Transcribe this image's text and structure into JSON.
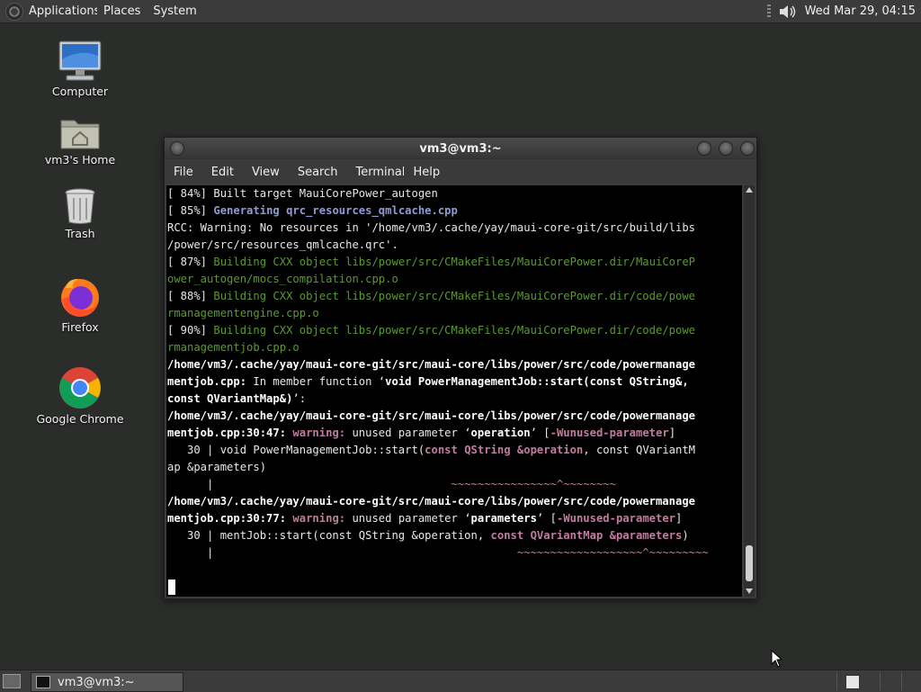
{
  "top_panel": {
    "menus": [
      "Applications",
      "Places",
      "System"
    ],
    "clock": "Wed Mar 29, 04:15"
  },
  "desktop_icons": [
    {
      "label": "Computer",
      "icon": "computer-icon"
    },
    {
      "label": "vm3's Home",
      "icon": "home-folder-icon"
    },
    {
      "label": "Trash",
      "icon": "trash-icon"
    },
    {
      "label": "Firefox",
      "icon": "firefox-icon"
    },
    {
      "label": "Google Chrome",
      "icon": "chrome-icon"
    }
  ],
  "window": {
    "title": "vm3@vm3:~",
    "menus": [
      "File",
      "Edit",
      "View",
      "Search",
      "Terminal",
      "Help"
    ]
  },
  "terminal": {
    "lines": [
      [
        {
          "t": "[ 84%] Built target MauiCorePower_autogen"
        }
      ],
      [
        {
          "t": "[ 85%] "
        },
        {
          "t": "Generating qrc_resources_qmlcache.cpp",
          "s": "blue"
        }
      ],
      [
        {
          "t": "RCC: Warning: No resources in '/home/vm3/.cache/yay/maui-core-git/src/build/libs"
        }
      ],
      [
        {
          "t": "/power/src/resources_qmlcache.qrc'."
        }
      ],
      [
        {
          "t": "[ 87%] "
        },
        {
          "t": "Building CXX object libs/power/src/CMakeFiles/MauiCorePower.dir/MauiCoreP",
          "s": "green"
        }
      ],
      [
        {
          "t": "ower_autogen/mocs_compilation.cpp.o",
          "s": "green"
        }
      ],
      [
        {
          "t": "[ 88%] "
        },
        {
          "t": "Building CXX object libs/power/src/CMakeFiles/MauiCorePower.dir/code/powe",
          "s": "green"
        }
      ],
      [
        {
          "t": "rmanagementengine.cpp.o",
          "s": "green"
        }
      ],
      [
        {
          "t": "[ 90%] "
        },
        {
          "t": "Building CXX object libs/power/src/CMakeFiles/MauiCorePower.dir/code/powe",
          "s": "green"
        }
      ],
      [
        {
          "t": "rmanagementjob.cpp.o",
          "s": "green"
        }
      ],
      [
        {
          "t": "/home/vm3/.cache/yay/maui-core-git/src/maui-core/libs/power/src/code/powermanage",
          "s": "bold"
        }
      ],
      [
        {
          "t": "mentjob.cpp:",
          "s": "bold"
        },
        {
          "t": " In member function ‘"
        },
        {
          "t": "void PowerManagementJob::start(const QString&,",
          "s": "bold"
        }
      ],
      [
        {
          "t": "const QVariantMap&)",
          "s": "bold"
        },
        {
          "t": "’:"
        }
      ],
      [
        {
          "t": "/home/vm3/.cache/yay/maui-core-git/src/maui-core/libs/power/src/code/powermanage",
          "s": "bold"
        }
      ],
      [
        {
          "t": "mentjob.cpp:30:47:",
          "s": "bold"
        },
        {
          "t": " "
        },
        {
          "t": "warning:",
          "s": "warn"
        },
        {
          "t": " unused parameter ‘"
        },
        {
          "t": "operation",
          "s": "bold"
        },
        {
          "t": "’ ["
        },
        {
          "t": "-Wunused-parameter",
          "s": "warn"
        },
        {
          "t": "]"
        }
      ],
      [
        {
          "t": "   30 | void PowerManagementJob::start("
        },
        {
          "t": "const QString &operation",
          "s": "pinkb"
        },
        {
          "t": ", const QVariantM"
        }
      ],
      [
        {
          "t": "ap &parameters)"
        }
      ],
      [
        {
          "t": "      |                                    "
        },
        {
          "t": "~~~~~~~~~~~~~~~~^~~~~~~~~",
          "s": "tilde"
        }
      ],
      [
        {
          "t": "/home/vm3/.cache/yay/maui-core-git/src/maui-core/libs/power/src/code/powermanage",
          "s": "bold"
        }
      ],
      [
        {
          "t": "mentjob.cpp:30:77:",
          "s": "bold"
        },
        {
          "t": " "
        },
        {
          "t": "warning:",
          "s": "warn"
        },
        {
          "t": " unused parameter ‘"
        },
        {
          "t": "parameters",
          "s": "bold"
        },
        {
          "t": "’ ["
        },
        {
          "t": "-Wunused-parameter",
          "s": "warn"
        },
        {
          "t": "]"
        }
      ],
      [
        {
          "t": "   30 | mentJob::start(const QString &operation, "
        },
        {
          "t": "const QVariantMap &parameters",
          "s": "pinkb"
        },
        {
          "t": ")"
        }
      ],
      [
        {
          "t": "      |                                              "
        },
        {
          "t": "~~~~~~~~~~~~~~~~~~~^~~~~~~~~~",
          "s": "tilde"
        }
      ],
      [
        {
          "t": ""
        }
      ]
    ]
  },
  "taskbar": {
    "tasks": [
      {
        "label": "vm3@vm3:~"
      }
    ]
  }
}
